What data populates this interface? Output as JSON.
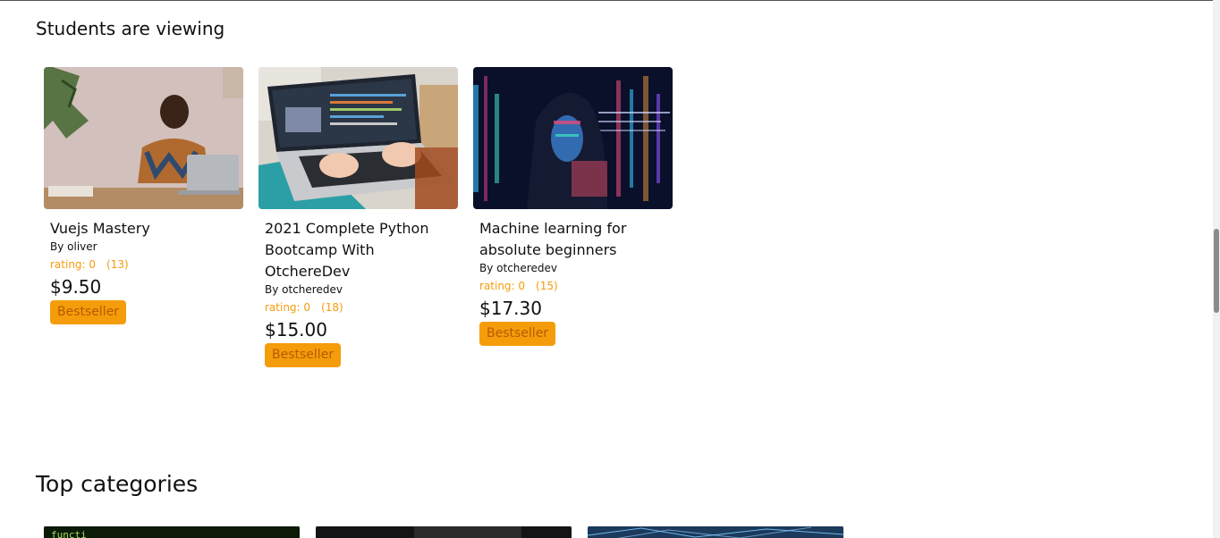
{
  "students_viewing": {
    "title": "Students are viewing",
    "courses": [
      {
        "title": "Vuejs Mastery",
        "author": "By oliver",
        "rating": "rating: 0",
        "count": "(13)",
        "price": "$9.50",
        "badge": "Bestseller",
        "image": "man-laptop-photo"
      },
      {
        "title": "2021 Complete Python Bootcamp With OtchereDev",
        "author": "By otcheredev",
        "rating": "rating: 0",
        "count": "(18)",
        "price": "$15.00",
        "badge": "Bestseller",
        "image": "laptop-code-photo"
      },
      {
        "title": "Machine learning for absolute beginners",
        "author": "By otcheredev",
        "rating": "rating: 0",
        "count": "(15)",
        "price": "$17.30",
        "badge": "Bestseller",
        "image": "hooded-figure-data-photo"
      }
    ]
  },
  "top_categories": {
    "title": "Top categories",
    "categories": [
      {
        "image": "code-screen-photo",
        "code_text": "functi"
      },
      {
        "image": "dark-photo"
      },
      {
        "image": "network-photo"
      }
    ]
  },
  "colors": {
    "accent": "#f59c0b",
    "badge_text": "#b75b00"
  }
}
